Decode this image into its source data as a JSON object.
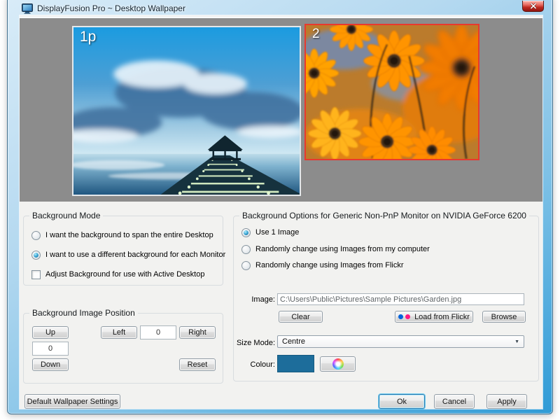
{
  "window": {
    "title": "DisplayFusion Pro ~ Desktop Wallpaper"
  },
  "preview": {
    "selected_border_color": "#e8392e",
    "monitors": [
      {
        "label": "1p",
        "selected": false
      },
      {
        "label": "2",
        "selected": true
      }
    ]
  },
  "background_mode": {
    "title": "Background Mode",
    "options": [
      {
        "label": "I want the background to span the entire Desktop",
        "selected": false
      },
      {
        "label": "I want to use a different background for each Monitor",
        "selected": true
      }
    ],
    "active_desktop": {
      "label": "Adjust Background for use with Active Desktop",
      "checked": false
    }
  },
  "image_position": {
    "title": "Background Image Position",
    "up_label": "Up",
    "down_label": "Down",
    "left_label": "Left",
    "right_label": "Right",
    "reset_label": "Reset",
    "vertical_value": "0",
    "horizontal_value": "0"
  },
  "background_options": {
    "title": "Background Options for Generic Non-PnP Monitor on NVIDIA GeForce 6200",
    "options": [
      {
        "label": "Use 1 Image",
        "selected": true
      },
      {
        "label": "Randomly change using Images from my computer",
        "selected": false
      },
      {
        "label": "Randomly change using Images from Flickr",
        "selected": false
      }
    ],
    "image_label": "Image:",
    "image_path": "C:\\Users\\Public\\Pictures\\Sample Pictures\\Garden.jpg",
    "clear_label": "Clear",
    "flickr_label": "Load from Flickr",
    "flickr_dot_colors": [
      "#0063dc",
      "#ff1981"
    ],
    "browse_label": "Browse",
    "size_mode_label": "Size Mode:",
    "size_mode_value": "Centre",
    "dropdown_arrow": "▼",
    "colour_label": "Colour:",
    "colour_value": "#1d6d9b"
  },
  "footer": {
    "default_label": "Default Wallpaper Settings",
    "ok_label": "Ok",
    "cancel_label": "Cancel",
    "apply_label": "Apply"
  }
}
